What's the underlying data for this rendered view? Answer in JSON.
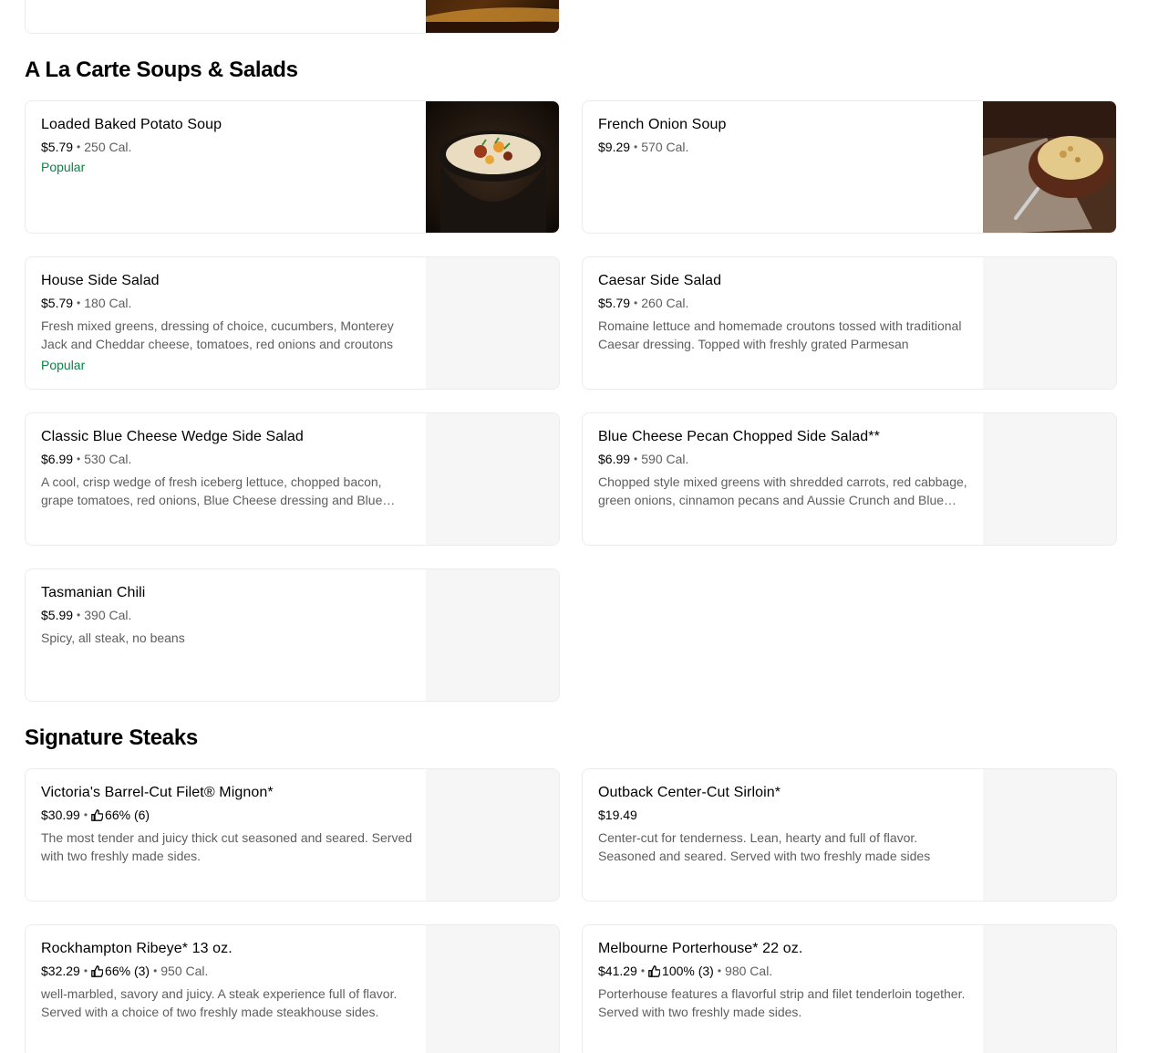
{
  "sections": [
    {
      "title": "A La Carte Soups & Salads",
      "items": [
        {
          "name": "Loaded Baked Potato Soup",
          "price": "$5.79",
          "calories": "250 Cal.",
          "description": "",
          "badge": "Popular"
        },
        {
          "name": "French Onion Soup",
          "price": "$9.29",
          "calories": "570 Cal.",
          "description": "",
          "badge": ""
        },
        {
          "name": "House Side Salad",
          "price": "$5.79",
          "calories": "180 Cal.",
          "description": "Fresh mixed greens, dressing of choice, cucumbers, Monterey Jack and Cheddar cheese, tomatoes, red onions and croutons",
          "badge": "Popular"
        },
        {
          "name": "Caesar Side Salad",
          "price": "$5.79",
          "calories": "260 Cal.",
          "description": "Romaine lettuce and homemade croutons tossed with traditional Caesar dressing. Topped with freshly grated Parmesan",
          "badge": ""
        },
        {
          "name": "Classic Blue Cheese Wedge Side Salad",
          "price": "$6.99",
          "calories": "530 Cal.",
          "description": "A cool, crisp wedge of fresh iceberg lettuce, chopped bacon, grape tomatoes, red onions, Blue Cheese dressing and Blue Cheese crumbles",
          "badge": ""
        },
        {
          "name": "Blue Cheese Pecan Chopped Side Salad**",
          "price": "$6.99",
          "calories": "590 Cal.",
          "description": "Chopped style mixed greens with shredded carrots, red cabbage, green onions, cinnamon pecans and Aussie Crunch and Blue Cheese",
          "badge": ""
        },
        {
          "name": "Tasmanian Chili",
          "price": "$5.99",
          "calories": "390 Cal.",
          "description": "Spicy, all steak, no beans",
          "badge": ""
        }
      ]
    },
    {
      "title": "Signature Steaks",
      "items": [
        {
          "name": "Victoria's Barrel-Cut Filet® Mignon*",
          "price": "$30.99",
          "rating": "66% (6)",
          "calories": "",
          "description": "The most tender and juicy thick cut seasoned and seared. Served with two freshly made sides.",
          "badge": ""
        },
        {
          "name": "Outback Center-Cut Sirloin*",
          "price": "$19.49",
          "calories": "",
          "description": "Center-cut for tenderness. Lean, hearty and full of flavor. Seasoned and seared. Served with two freshly made sides",
          "badge": ""
        },
        {
          "name": "Rockhampton Ribeye* 13 oz.",
          "price": "$32.29",
          "rating": "66% (3)",
          "calories": "950 Cal.",
          "description": "well-marbled, savory and juicy. A steak experience full of flavor. Served with a choice of two freshly made steakhouse sides.",
          "badge": ""
        },
        {
          "name": "Melbourne Porterhouse* 22 oz.",
          "price": "$41.29",
          "rating": "100% (3)",
          "calories": "980 Cal.",
          "description": "Porterhouse features a flavorful strip and filet tenderloin together. Served with two freshly made sides.",
          "badge": ""
        }
      ]
    }
  ],
  "separator": "•",
  "colors": {
    "popular": "#0e8345",
    "muted_text": "#5e5e5e",
    "image_placeholder": "#f6f6f6",
    "card_border": "#ececec"
  },
  "icons": {
    "rating": "thumbs-up-icon"
  }
}
